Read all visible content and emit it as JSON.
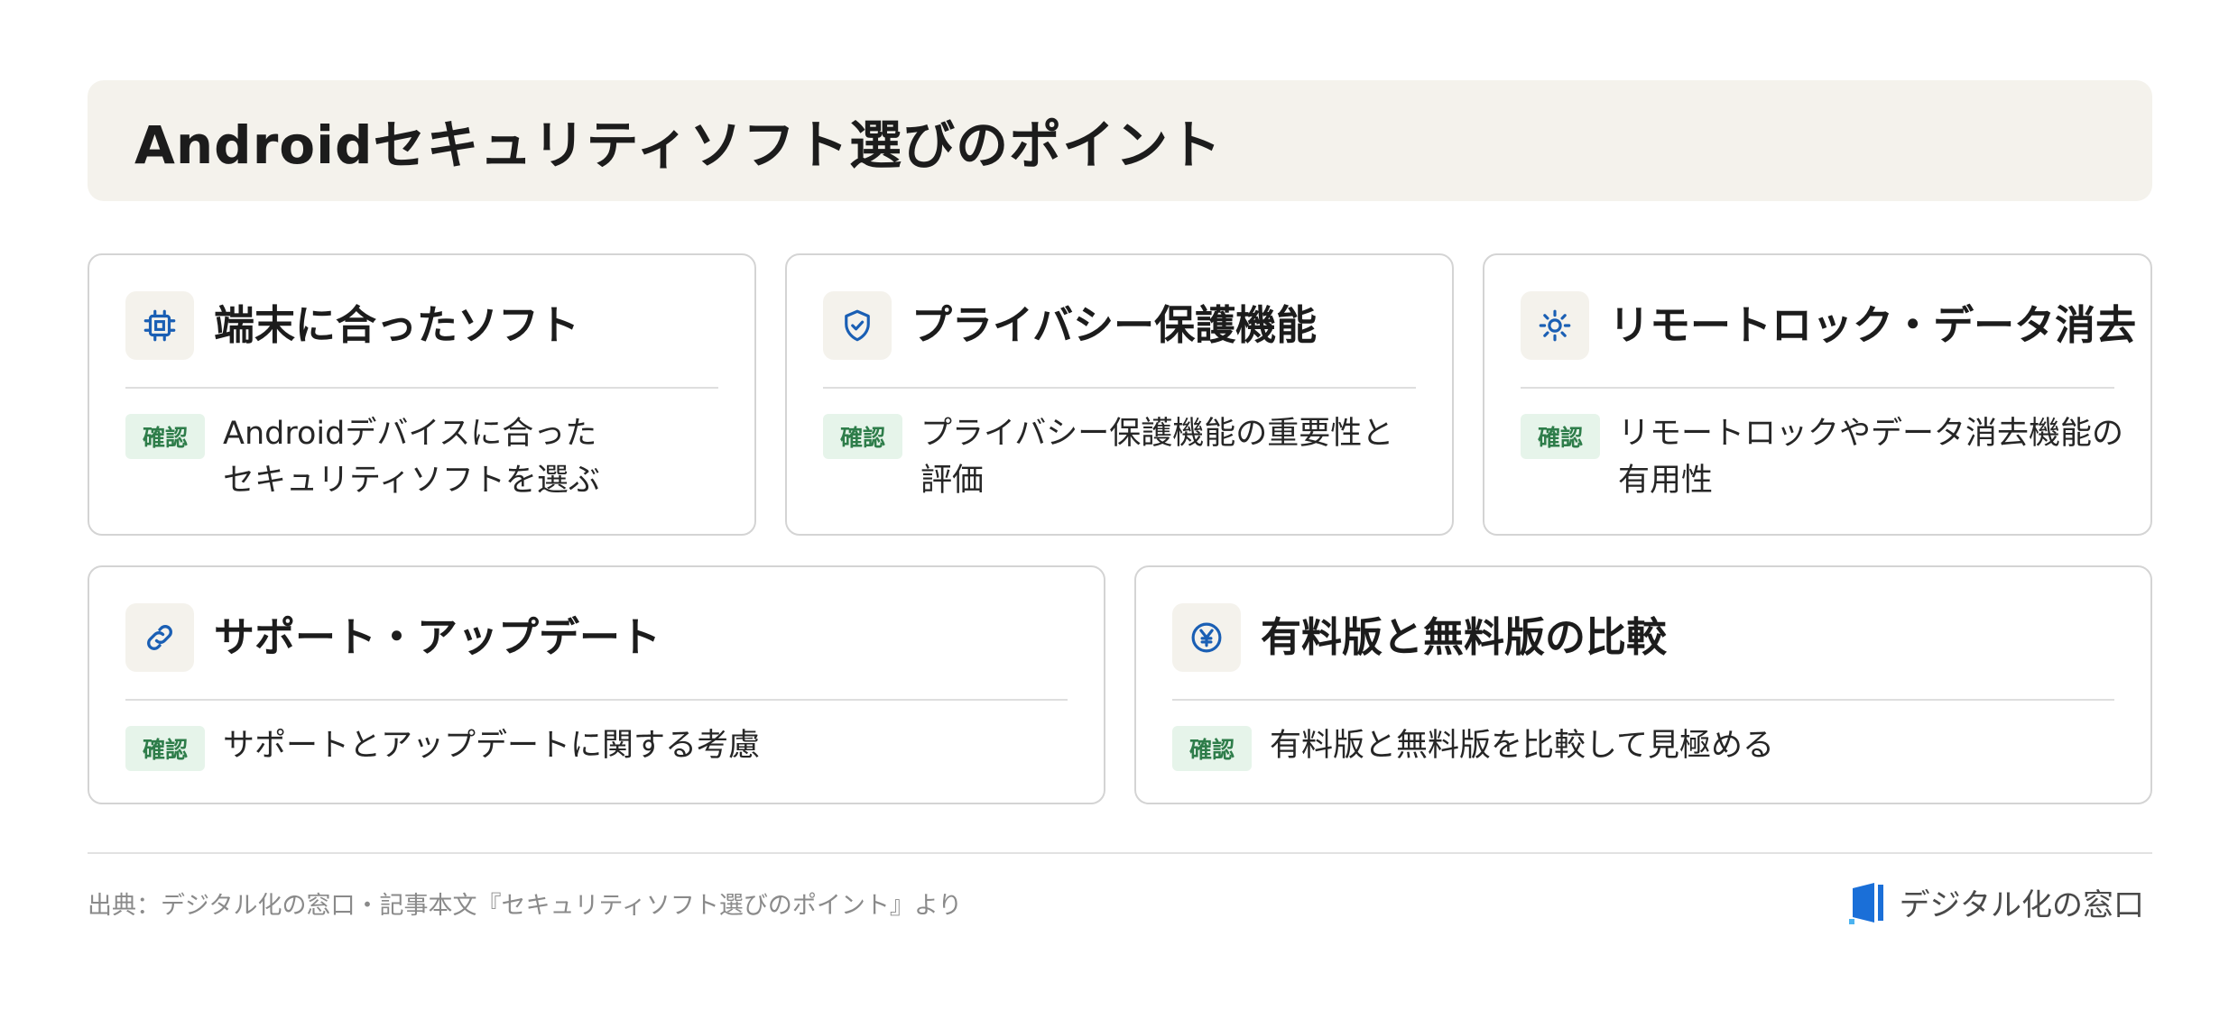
{
  "header": {
    "title": "Androidセキュリティソフト選びのポイント"
  },
  "cards": [
    {
      "icon": "chip-icon",
      "title": "端末に合ったソフト",
      "badge": "確認",
      "text_line1": "Androidデバイスに合った",
      "text_line2": "セキュリティソフトを選ぶ"
    },
    {
      "icon": "shield-check-icon",
      "title": "プライバシー保護機能",
      "badge": "確認",
      "text_line1": "プライバシー保護機能の重要性と",
      "text_line2": "評価"
    },
    {
      "icon": "sun-icon",
      "title": "リモートロック・データ消去",
      "badge": "確認",
      "text_line1": "リモートロックやデータ消去機能の",
      "text_line2": "有用性"
    },
    {
      "icon": "link-icon",
      "title": "サポート・アップデート",
      "badge": "確認",
      "text_line1": "サポートとアップデートに関する考慮"
    },
    {
      "icon": "yen-circle-icon",
      "title": "有料版と無料版の比較",
      "badge": "確認",
      "text_line1": "有料版と無料版を比較して見極める"
    }
  ],
  "footer": {
    "source": "出典：デジタル化の窓口・記事本文『セキュリティソフト選びのポイント』より",
    "brand_name": "デジタル化の窓口"
  },
  "colors": {
    "accent_blue": "#1a5fb4",
    "badge_bg": "#e6f4ea",
    "badge_text": "#2e7d4a",
    "header_bg": "#f4f2ec"
  }
}
